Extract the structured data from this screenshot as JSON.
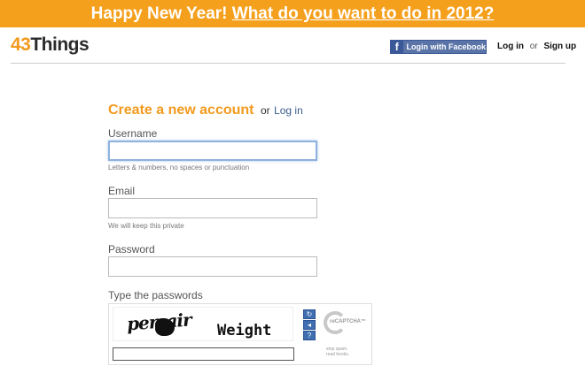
{
  "banner": {
    "greeting": "Happy New Year!",
    "link": "What do you want to do in 2012?"
  },
  "logo": {
    "number": "43",
    "word": "Things"
  },
  "header": {
    "facebook_label": "Login with Facebook",
    "login_label": "Log in",
    "or_text": "or",
    "signup_label": "Sign up"
  },
  "form": {
    "title": "Create a new account",
    "or_text": "or",
    "login_link": "Log in",
    "username": {
      "label": "Username",
      "value": "",
      "hint": "Letters & numbers, no spaces or punctuation"
    },
    "email": {
      "label": "Email",
      "value": "",
      "hint": "We will keep this private"
    },
    "password": {
      "label": "Password",
      "value": ""
    },
    "captcha": {
      "label": "Type the passwords",
      "word1": "persair",
      "word2": "Weight",
      "value": "",
      "brand": "reCAPTCHA™",
      "tagline_1": "stop spam.",
      "tagline_2": "read books."
    }
  },
  "colors": {
    "banner": "#f5a01c",
    "accent": "#f39a1d",
    "facebook": "#3b5998",
    "link": "#3a5b8c"
  }
}
